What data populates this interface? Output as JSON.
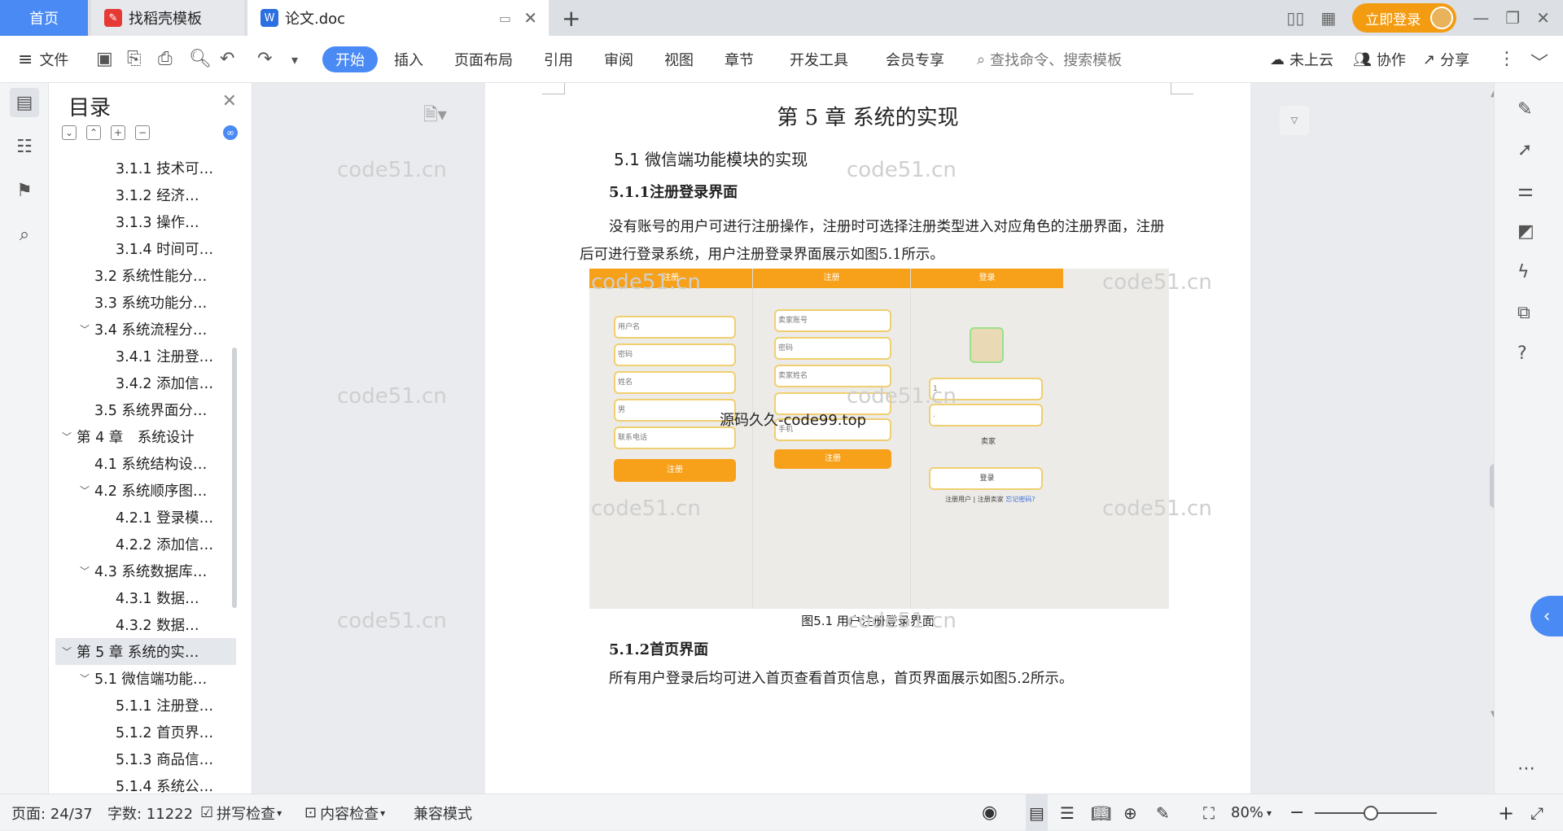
{
  "tabs": {
    "home": "首页",
    "templates": "找稻壳模板",
    "doc": "论文.doc",
    "new_tab": "+"
  },
  "header": {
    "login": "立即登录"
  },
  "toolbar": {
    "file": "文件",
    "start": "开始",
    "insert": "插入",
    "layout": "页面布局",
    "ref": "引用",
    "review": "审阅",
    "view": "视图",
    "chapter": "章节",
    "dev": "开发工具",
    "vip": "会员专享",
    "search": "查找命令、搜索模板",
    "cloud": "未上云",
    "collab": "协作",
    "share": "分享"
  },
  "toc": {
    "title": "目录",
    "items": [
      {
        "label": "3.1.1 技术可…",
        "level": 3
      },
      {
        "label": "3.1.2 经济…",
        "level": 3
      },
      {
        "label": "3.1.3 操作…",
        "level": 3
      },
      {
        "label": "3.1.4 时间可…",
        "level": 3
      },
      {
        "label": "3.2 系统性能分…",
        "level": 2
      },
      {
        "label": "3.3 系统功能分…",
        "level": 2
      },
      {
        "label": "3.4 系统流程分…",
        "level": 2,
        "arrow": "﹀"
      },
      {
        "label": "3.4.1 注册登…",
        "level": 3
      },
      {
        "label": "3.4.2 添加信…",
        "level": 3
      },
      {
        "label": "3.5 系统界面分…",
        "level": 2
      },
      {
        "label": "第 4 章　系统设计",
        "level": 1,
        "arrow": "﹀"
      },
      {
        "label": "4.1 系统结构设…",
        "level": 2
      },
      {
        "label": "4.2 系统顺序图…",
        "level": 2,
        "arrow": "﹀"
      },
      {
        "label": "4.2.1 登录模…",
        "level": 3
      },
      {
        "label": "4.2.2 添加信…",
        "level": 3
      },
      {
        "label": "4.3 系统数据库…",
        "level": 2,
        "arrow": "﹀"
      },
      {
        "label": "4.3.1 数据…",
        "level": 3
      },
      {
        "label": "4.3.2 数据…",
        "level": 3
      },
      {
        "label": "第 5 章 系统的实…",
        "level": 1,
        "arrow": "﹀",
        "selected": true
      },
      {
        "label": "5.1 微信端功能…",
        "level": 2,
        "arrow": "﹀"
      },
      {
        "label": "5.1.1 注册登…",
        "level": 3
      },
      {
        "label": "5.1.2 首页界…",
        "level": 3
      },
      {
        "label": "5.1.3 商品信…",
        "level": 3
      },
      {
        "label": "5.1.4 系统公…",
        "level": 3
      }
    ]
  },
  "doc": {
    "chapter": "第 5 章 系统的实现",
    "section": "5.1 微信端功能模块的实现",
    "sub1": "5.1.1注册登录界面",
    "para1": "没有账号的用户可进行注册操作，注册时可选择注册类型进入对应角色的注册界面，注册后可进行登录系统，用户注册登录界面展示如图5.1所示。",
    "figure": {
      "phone1": {
        "header": "注册",
        "fields": [
          "用户名",
          "密码",
          "姓名",
          "男",
          "联系电话"
        ],
        "button": "注册"
      },
      "phone2": {
        "header": "注册",
        "fields": [
          "卖家账号",
          "密码",
          "卖家姓名",
          "",
          "手机"
        ],
        "button": "注册"
      },
      "phone3": {
        "header": "登录",
        "fields": [
          "1",
          "."
        ],
        "label": "卖家",
        "button": "登录",
        "links": "注册用户 | 注册卖家",
        "forgot": "忘记密码?"
      },
      "overlay": "源码久久-code99.top",
      "caption": "图5.1 用户注册登录界面"
    },
    "sub2": "5.1.2首页界面",
    "para2": "所有用户登录后均可进入首页查看首页信息，首页界面展示如图5.2所示。",
    "watermark": "code51.cn"
  },
  "status": {
    "page": "页面: 24/37",
    "words": "字数: 11222",
    "spell": "拼写检查",
    "content": "内容检查",
    "compat": "兼容模式",
    "zoom": "80%",
    "zoom_level": 0.46
  }
}
